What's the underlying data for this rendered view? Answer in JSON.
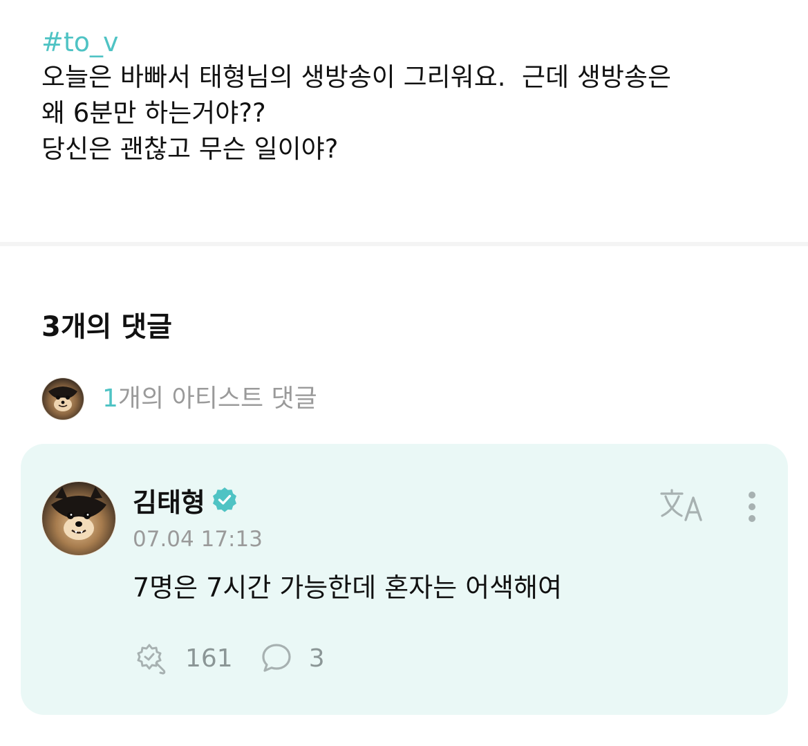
{
  "post": {
    "hashtag": "#to_v",
    "body": "오늘은 바빠서 태형님의 생방송이 그리워요.  근데 생방송은\n왜 6분만 하는거야??\n당신은 괜찮고 무슨 일이야?"
  },
  "comments_section": {
    "title": "3개의 댓글",
    "artist_summary": {
      "count": "1",
      "label": "개의 아티스트 댓글"
    }
  },
  "comment": {
    "author": "김태형",
    "timestamp": "07.04 17:13",
    "text": "7명은 7시간 가능한데 혼자는 어색해여",
    "like_count": "161",
    "reply_count": "3"
  },
  "icons": {
    "verified": "verified-badge-icon",
    "translate": "translate-icon",
    "more": "more-vertical-icon",
    "like": "like-icon",
    "reply": "reply-bubble-icon"
  },
  "colors": {
    "accent": "#4fc3c4",
    "card_background": "#eaf8f6",
    "muted_text": "#9a9a9a",
    "icon_gray": "#a7b1b1"
  }
}
